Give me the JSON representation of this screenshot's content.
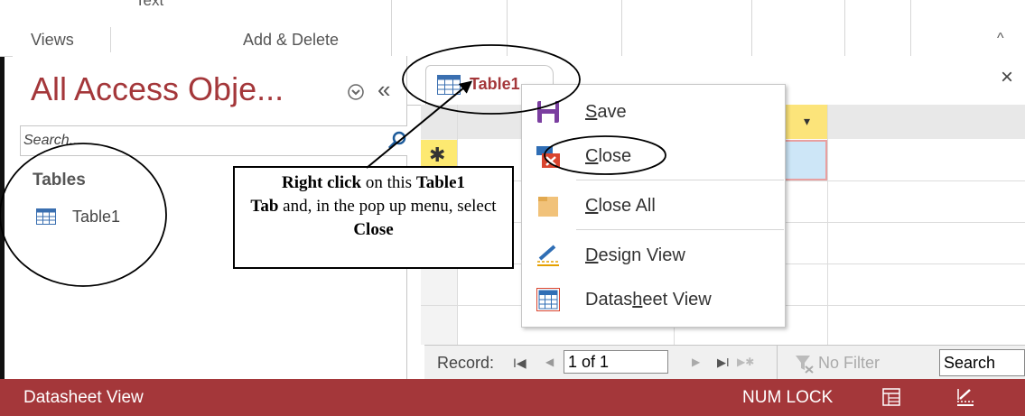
{
  "ribbon": {
    "partial_top_label": "Text",
    "group_views": "Views",
    "group_add_delete": "Add & Delete",
    "collapse_glyph": "^"
  },
  "nav_pane": {
    "title": "All Access Obje...",
    "menu_icon": "chevron-circle-down-icon",
    "collapse_glyph": "«",
    "search_placeholder": "Search...",
    "section": "Tables",
    "items": [
      {
        "label": "Table1",
        "icon": "table-icon"
      }
    ]
  },
  "document": {
    "tab_label": "Table1",
    "close_glyph": "×",
    "new_row_marker": "✱"
  },
  "context_menu": {
    "items": [
      {
        "label_pre": "",
        "label_key": "S",
        "label_post": "ave",
        "icon": "save-icon"
      },
      {
        "label_pre": "",
        "label_key": "C",
        "label_post": "lose",
        "icon": "close-tab-icon"
      },
      {
        "label_pre": "",
        "label_key": "C",
        "label_post": "lose All",
        "icon": "folder-icon"
      },
      {
        "label_pre": "",
        "label_key": "D",
        "label_post": "esign View",
        "icon": "design-view-icon"
      },
      {
        "label_pre": "Datas",
        "label_key": "h",
        "label_post": "eet View",
        "icon": "datasheet-view-icon"
      }
    ]
  },
  "record_nav": {
    "label": "Record:",
    "first": "I◀",
    "prev": "◀",
    "current": "1 of 1",
    "next": "▶",
    "last": "▶I",
    "new": "▶✱",
    "filter": "No Filter",
    "search": "Search"
  },
  "status_bar": {
    "view_name": "Datasheet View",
    "num_lock": "NUM LOCK"
  },
  "annotation": {
    "bold_1": "Right click",
    "text_1": " on this ",
    "bold_2": "Table1",
    "bold_3": "Tab",
    "text_2": " and, in the pop up menu, select ",
    "bold_4": "Close"
  },
  "colors": {
    "access_red": "#a4373a",
    "new_row_yellow": "#fde971",
    "selected_cell": "#cde6f7",
    "field_header_yellow": "#fce47a"
  }
}
